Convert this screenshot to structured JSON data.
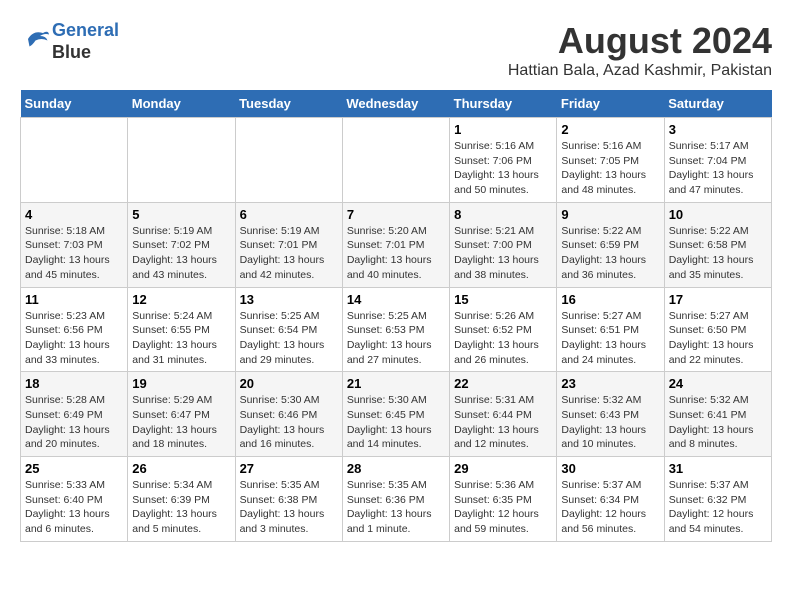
{
  "logo": {
    "line1": "General",
    "line2": "Blue"
  },
  "title": "August 2024",
  "subtitle": "Hattian Bala, Azad Kashmir, Pakistan",
  "weekdays": [
    "Sunday",
    "Monday",
    "Tuesday",
    "Wednesday",
    "Thursday",
    "Friday",
    "Saturday"
  ],
  "weeks": [
    [
      {
        "day": "",
        "info": ""
      },
      {
        "day": "",
        "info": ""
      },
      {
        "day": "",
        "info": ""
      },
      {
        "day": "",
        "info": ""
      },
      {
        "day": "1",
        "info": "Sunrise: 5:16 AM\nSunset: 7:06 PM\nDaylight: 13 hours\nand 50 minutes."
      },
      {
        "day": "2",
        "info": "Sunrise: 5:16 AM\nSunset: 7:05 PM\nDaylight: 13 hours\nand 48 minutes."
      },
      {
        "day": "3",
        "info": "Sunrise: 5:17 AM\nSunset: 7:04 PM\nDaylight: 13 hours\nand 47 minutes."
      }
    ],
    [
      {
        "day": "4",
        "info": "Sunrise: 5:18 AM\nSunset: 7:03 PM\nDaylight: 13 hours\nand 45 minutes."
      },
      {
        "day": "5",
        "info": "Sunrise: 5:19 AM\nSunset: 7:02 PM\nDaylight: 13 hours\nand 43 minutes."
      },
      {
        "day": "6",
        "info": "Sunrise: 5:19 AM\nSunset: 7:01 PM\nDaylight: 13 hours\nand 42 minutes."
      },
      {
        "day": "7",
        "info": "Sunrise: 5:20 AM\nSunset: 7:01 PM\nDaylight: 13 hours\nand 40 minutes."
      },
      {
        "day": "8",
        "info": "Sunrise: 5:21 AM\nSunset: 7:00 PM\nDaylight: 13 hours\nand 38 minutes."
      },
      {
        "day": "9",
        "info": "Sunrise: 5:22 AM\nSunset: 6:59 PM\nDaylight: 13 hours\nand 36 minutes."
      },
      {
        "day": "10",
        "info": "Sunrise: 5:22 AM\nSunset: 6:58 PM\nDaylight: 13 hours\nand 35 minutes."
      }
    ],
    [
      {
        "day": "11",
        "info": "Sunrise: 5:23 AM\nSunset: 6:56 PM\nDaylight: 13 hours\nand 33 minutes."
      },
      {
        "day": "12",
        "info": "Sunrise: 5:24 AM\nSunset: 6:55 PM\nDaylight: 13 hours\nand 31 minutes."
      },
      {
        "day": "13",
        "info": "Sunrise: 5:25 AM\nSunset: 6:54 PM\nDaylight: 13 hours\nand 29 minutes."
      },
      {
        "day": "14",
        "info": "Sunrise: 5:25 AM\nSunset: 6:53 PM\nDaylight: 13 hours\nand 27 minutes."
      },
      {
        "day": "15",
        "info": "Sunrise: 5:26 AM\nSunset: 6:52 PM\nDaylight: 13 hours\nand 26 minutes."
      },
      {
        "day": "16",
        "info": "Sunrise: 5:27 AM\nSunset: 6:51 PM\nDaylight: 13 hours\nand 24 minutes."
      },
      {
        "day": "17",
        "info": "Sunrise: 5:27 AM\nSunset: 6:50 PM\nDaylight: 13 hours\nand 22 minutes."
      }
    ],
    [
      {
        "day": "18",
        "info": "Sunrise: 5:28 AM\nSunset: 6:49 PM\nDaylight: 13 hours\nand 20 minutes."
      },
      {
        "day": "19",
        "info": "Sunrise: 5:29 AM\nSunset: 6:47 PM\nDaylight: 13 hours\nand 18 minutes."
      },
      {
        "day": "20",
        "info": "Sunrise: 5:30 AM\nSunset: 6:46 PM\nDaylight: 13 hours\nand 16 minutes."
      },
      {
        "day": "21",
        "info": "Sunrise: 5:30 AM\nSunset: 6:45 PM\nDaylight: 13 hours\nand 14 minutes."
      },
      {
        "day": "22",
        "info": "Sunrise: 5:31 AM\nSunset: 6:44 PM\nDaylight: 13 hours\nand 12 minutes."
      },
      {
        "day": "23",
        "info": "Sunrise: 5:32 AM\nSunset: 6:43 PM\nDaylight: 13 hours\nand 10 minutes."
      },
      {
        "day": "24",
        "info": "Sunrise: 5:32 AM\nSunset: 6:41 PM\nDaylight: 13 hours\nand 8 minutes."
      }
    ],
    [
      {
        "day": "25",
        "info": "Sunrise: 5:33 AM\nSunset: 6:40 PM\nDaylight: 13 hours\nand 6 minutes."
      },
      {
        "day": "26",
        "info": "Sunrise: 5:34 AM\nSunset: 6:39 PM\nDaylight: 13 hours\nand 5 minutes."
      },
      {
        "day": "27",
        "info": "Sunrise: 5:35 AM\nSunset: 6:38 PM\nDaylight: 13 hours\nand 3 minutes."
      },
      {
        "day": "28",
        "info": "Sunrise: 5:35 AM\nSunset: 6:36 PM\nDaylight: 13 hours\nand 1 minute."
      },
      {
        "day": "29",
        "info": "Sunrise: 5:36 AM\nSunset: 6:35 PM\nDaylight: 12 hours\nand 59 minutes."
      },
      {
        "day": "30",
        "info": "Sunrise: 5:37 AM\nSunset: 6:34 PM\nDaylight: 12 hours\nand 56 minutes."
      },
      {
        "day": "31",
        "info": "Sunrise: 5:37 AM\nSunset: 6:32 PM\nDaylight: 12 hours\nand 54 minutes."
      }
    ]
  ]
}
